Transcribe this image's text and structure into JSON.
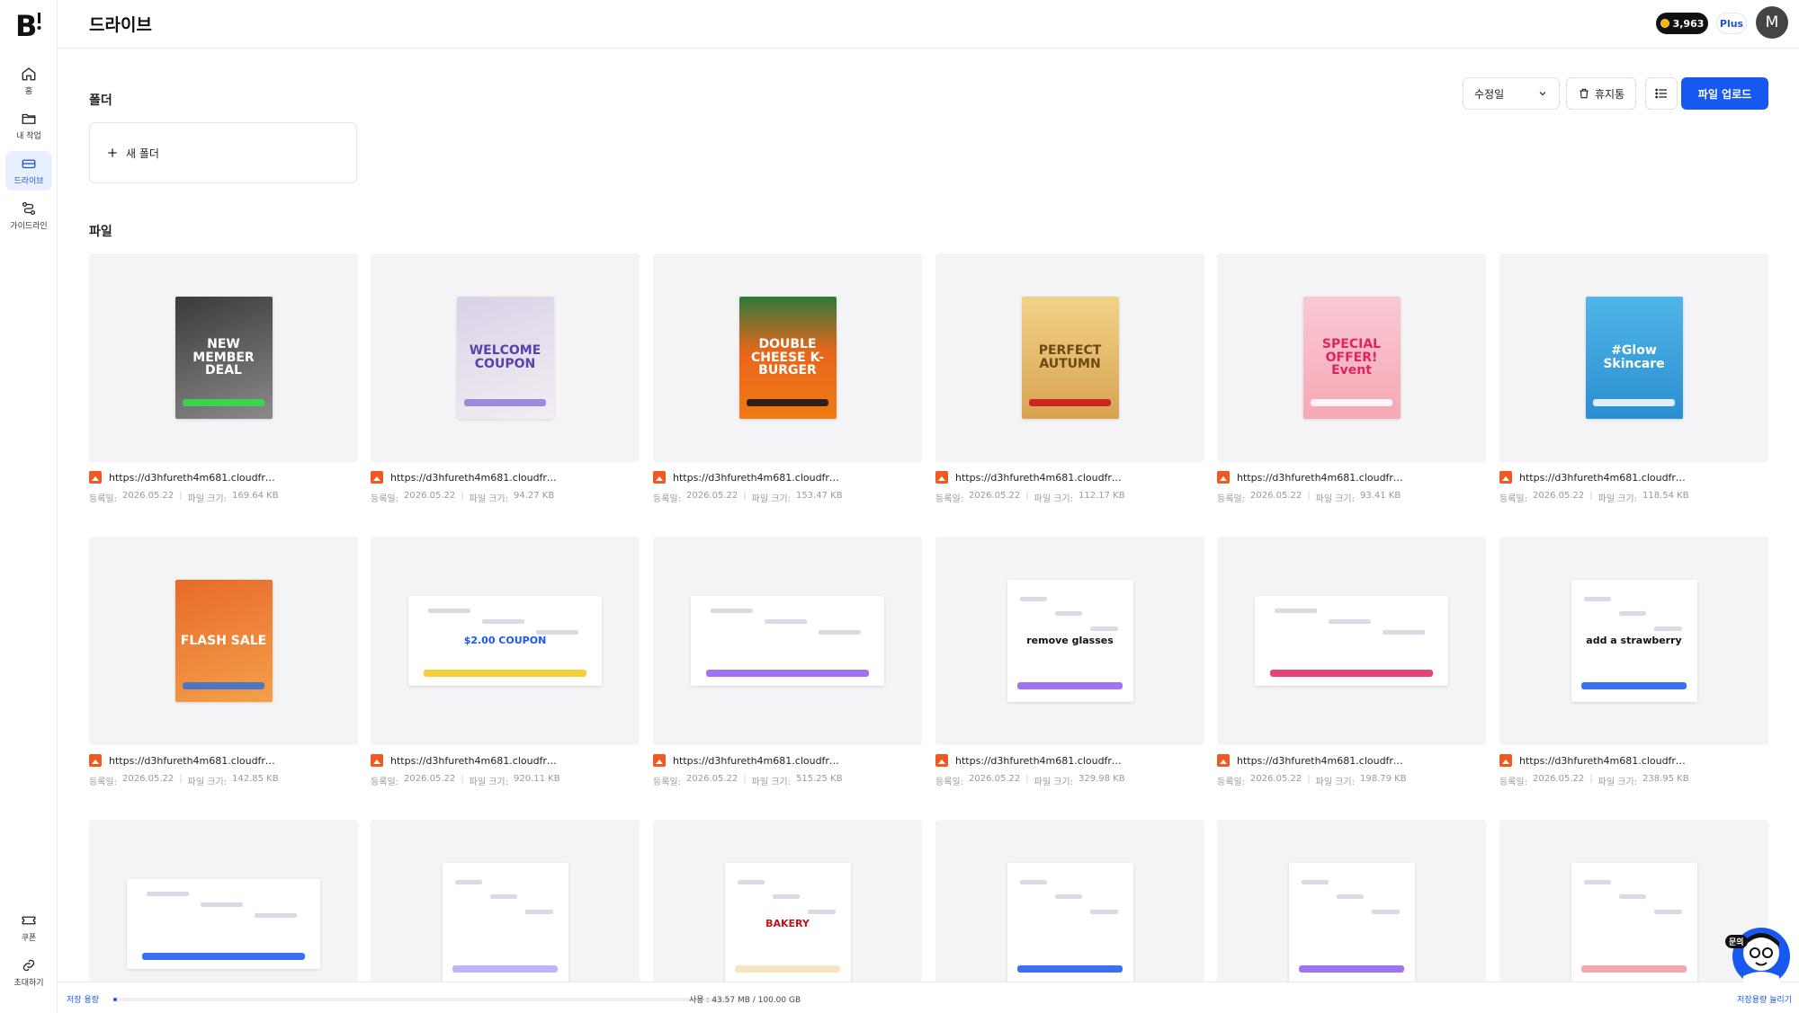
{
  "app": {
    "title": "드라이브"
  },
  "sidebar": {
    "items": [
      {
        "label": "홈",
        "icon": "home-icon"
      },
      {
        "label": "내 작업",
        "icon": "folder-icon"
      },
      {
        "label": "드라이브",
        "icon": "drive-icon",
        "active": true
      },
      {
        "label": "가이드라인",
        "icon": "guideline-icon"
      }
    ],
    "bottom_items": [
      {
        "label": "쿠폰",
        "icon": "coupon-icon"
      },
      {
        "label": "초대하기",
        "icon": "link-icon"
      }
    ]
  },
  "header": {
    "credits": "3,963",
    "plan": "Plus",
    "avatar_initial": "M"
  },
  "toolbar": {
    "sort_value": "수정일",
    "trash_label": "휴지통",
    "upload_label": "파일 업로드"
  },
  "folders": {
    "section_label": "폴더",
    "new_folder_label": "새 폴더"
  },
  "files": {
    "section_label": "파일",
    "date_prefix": "등록일:",
    "size_prefix": "파일 크기:",
    "items": [
      {
        "name": "https://d3hfureth4m681.cloudfront...",
        "date": "2026.05.22",
        "size": "169.64 KB",
        "art": "NEW MEMBER DEAL"
      },
      {
        "name": "https://d3hfureth4m681.cloudfront...",
        "date": "2026.05.22",
        "size": "94.27 KB",
        "art": "WELCOME COUPON"
      },
      {
        "name": "https://d3hfureth4m681.cloudfront...",
        "date": "2026.05.22",
        "size": "153.47 KB",
        "art": "DOUBLE CHEESE K-BURGER"
      },
      {
        "name": "https://d3hfureth4m681.cloudfront...",
        "date": "2026.05.22",
        "size": "112.17 KB",
        "art": "PERFECT AUTUMN"
      },
      {
        "name": "https://d3hfureth4m681.cloudfront...",
        "date": "2026.05.22",
        "size": "93.41 KB",
        "art": "SPECIAL OFFER! Event"
      },
      {
        "name": "https://d3hfureth4m681.cloudfront...",
        "date": "2026.05.22",
        "size": "118.54 KB",
        "art": "#Glow Skincare"
      },
      {
        "name": "https://d3hfureth4m681.cloudfront...",
        "date": "2026.05.22",
        "size": "142.85 KB",
        "art": "FLASH SALE"
      },
      {
        "name": "https://d3hfureth4m681.cloudfront...",
        "date": "2026.05.22",
        "size": "920.11 KB",
        "art": "$2.00 COUPON"
      },
      {
        "name": "https://d3hfureth4m681.cloudfront...",
        "date": "2026.05.22",
        "size": "515.25 KB",
        "art": ""
      },
      {
        "name": "https://d3hfureth4m681.cloudfront...",
        "date": "2026.05.22",
        "size": "329.98 KB",
        "art": "remove glasses"
      },
      {
        "name": "https://d3hfureth4m681.cloudfront...",
        "date": "2026.05.22",
        "size": "198.79 KB",
        "art": ""
      },
      {
        "name": "https://d3hfureth4m681.cloudfront...",
        "date": "2026.05.22",
        "size": "238.95 KB",
        "art": "add a strawberry"
      },
      {
        "name": "",
        "date": "",
        "size": "",
        "art": ""
      },
      {
        "name": "",
        "date": "",
        "size": "",
        "art": ""
      },
      {
        "name": "",
        "date": "",
        "size": "",
        "art": "BAKERY"
      },
      {
        "name": "",
        "date": "",
        "size": "",
        "art": ""
      },
      {
        "name": "",
        "date": "",
        "size": "",
        "art": ""
      },
      {
        "name": "",
        "date": "",
        "size": "",
        "art": ""
      }
    ]
  },
  "storage": {
    "label": "저장 용량",
    "usage_text": "사용 : 43.57 MB / 100.00 GB",
    "used_fraction": 0.0004,
    "upgrade_label": "저장용량 늘리기"
  },
  "chat": {
    "label": "문의"
  },
  "colors": {
    "accent": "#1658f0",
    "active_bg": "#e8efff"
  }
}
